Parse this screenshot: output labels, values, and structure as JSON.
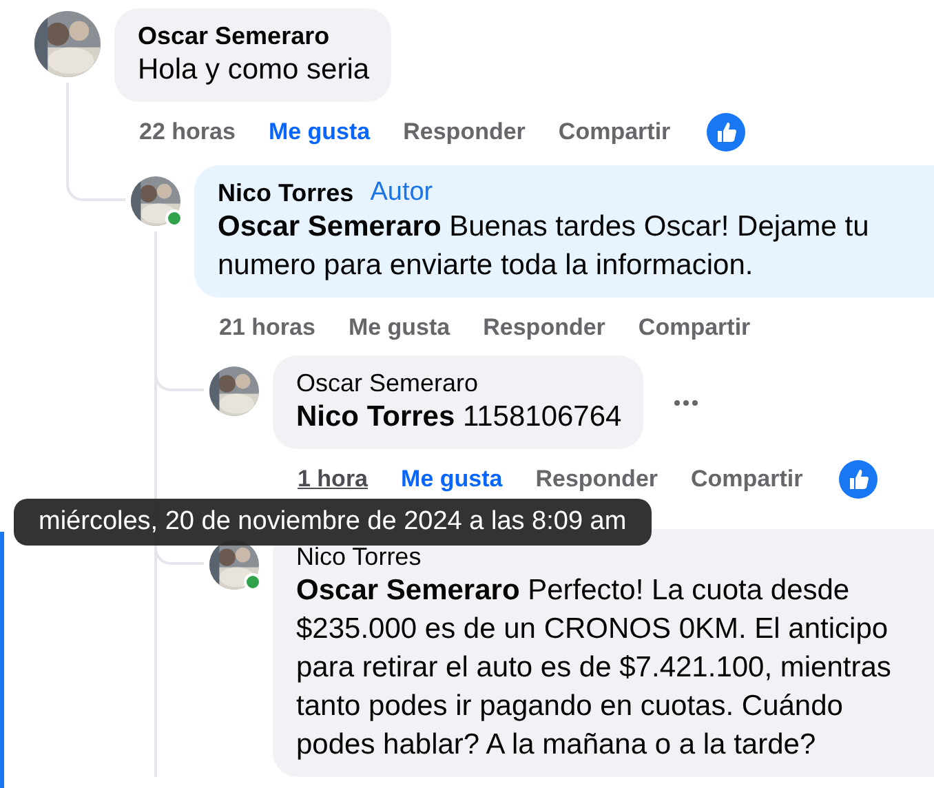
{
  "comments": [
    {
      "author": "Oscar Semeraro",
      "text": "Hola y como seria",
      "time": "22 horas",
      "like_label": "Me gusta",
      "reply_label": "Responder",
      "share_label": "Compartir",
      "liked": true,
      "highlighted": false,
      "children": [
        {
          "author": "Nico Torres",
          "badge": "Autor",
          "text": "**Oscar Semeraro** Buenas tardes Oscar! Dejame tu numero para enviarte toda la informacion.",
          "time": "21 horas",
          "like_label": "Me gusta",
          "reply_label": "Responder",
          "share_label": "Compartir",
          "liked": false,
          "online": true,
          "highlighted": true,
          "children": [
            {
              "author": "Oscar Semeraro",
              "text": "**Nico Torres** 1158106764",
              "time": "1 hora",
              "like_label": "Me gusta",
              "reply_label": "Responder",
              "share_label": "Compartir",
              "liked": true,
              "highlighted": false,
              "menu_visible": true,
              "time_hovered": true
            },
            {
              "author": "Nico Torres",
              "text": "**Oscar Semeraro** Perfecto! La cuota desde $235.000 es de un CRONOS 0KM. El anticipo para retirar el auto es de $7.421.100, mientras tanto podes ir pagando en cuotas. Cuándo podes hablar? A la mañana o a la tarde?",
              "online": true,
              "highlighted": false
            }
          ]
        }
      ]
    }
  ],
  "tooltip": {
    "text": "miércoles, 20 de noviembre de 2024 a las 8:09 am"
  }
}
